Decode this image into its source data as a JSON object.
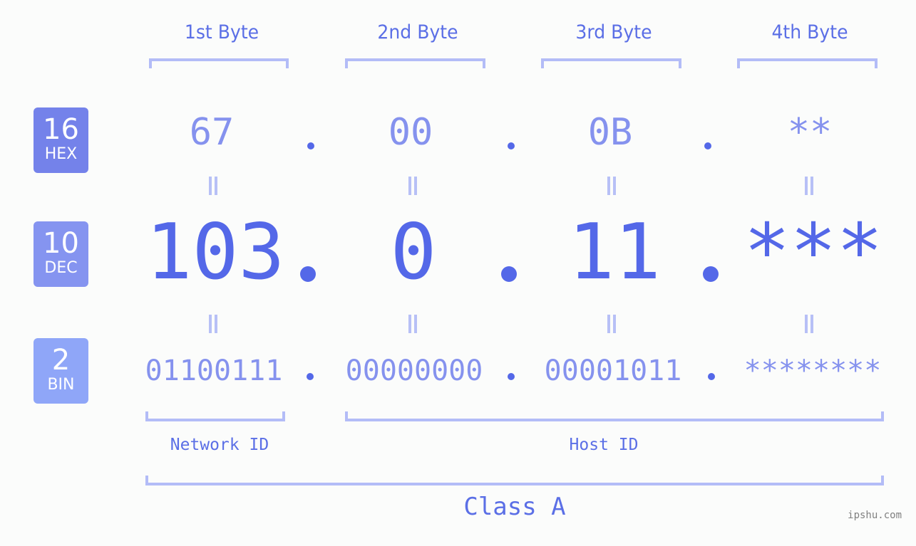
{
  "bytes": [
    {
      "label": "1st Byte",
      "hex": "67",
      "dec": "103",
      "bin": "01100111"
    },
    {
      "label": "2nd Byte",
      "hex": "00",
      "dec": "0",
      "bin": "00000000"
    },
    {
      "label": "3rd Byte",
      "hex": "0B",
      "dec": "11",
      "bin": "00001011"
    },
    {
      "label": "4th Byte",
      "hex": "**",
      "dec": "***",
      "bin": "********"
    }
  ],
  "bases": {
    "hex": {
      "num": "16",
      "name": "HEX",
      "color": "#7482ea"
    },
    "dec": {
      "num": "10",
      "name": "DEC",
      "color": "#8594f0"
    },
    "bin": {
      "num": "2",
      "name": "BIN",
      "color": "#8fa6f8"
    }
  },
  "separator": ".",
  "network_label": "Network ID",
  "host_label": "Host ID",
  "class_label": "Class A",
  "watermark": "ipshu.com",
  "colors": {
    "primary": "#5468e8",
    "light": "#8592ee",
    "bracket": "#b3bcf7"
  }
}
